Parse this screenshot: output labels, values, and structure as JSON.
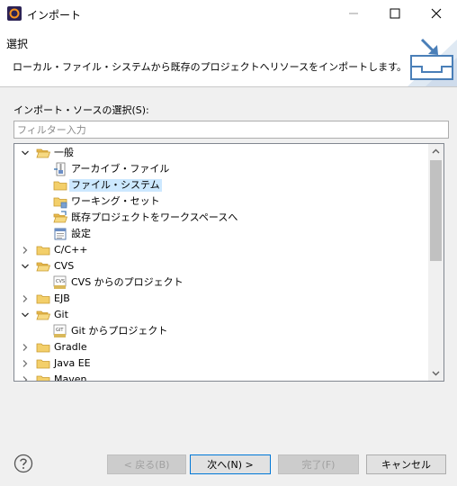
{
  "window": {
    "title": "インポート"
  },
  "banner": {
    "title": "選択",
    "description": "ローカル・ファイル・システムから既存のプロジェクトへリソースをインポートします。"
  },
  "source": {
    "label": "インポート・ソースの選択(S):",
    "filter_placeholder": "フィルター入力"
  },
  "tree": {
    "items": [
      {
        "label": "一般",
        "expanded": true,
        "icon": "folder-open-icon"
      },
      {
        "label": "アーカイブ・ファイル",
        "icon": "archive-file-icon"
      },
      {
        "label": "ファイル・システム",
        "icon": "folder-icon",
        "selected": true
      },
      {
        "label": "ワーキング・セット",
        "icon": "working-set-icon"
      },
      {
        "label": "既存プロジェクトをワークスペースへ",
        "icon": "project-folder-icon"
      },
      {
        "label": "設定",
        "icon": "settings-icon"
      },
      {
        "label": "C/C++",
        "expanded": false,
        "icon": "folder-icon"
      },
      {
        "label": "CVS",
        "expanded": true,
        "icon": "folder-open-icon"
      },
      {
        "label": "CVS からのプロジェクト",
        "icon": "cvs-icon"
      },
      {
        "label": "EJB",
        "expanded": false,
        "icon": "folder-icon"
      },
      {
        "label": "Git",
        "expanded": true,
        "icon": "folder-open-icon"
      },
      {
        "label": "Git からプロジェクト",
        "icon": "git-icon"
      },
      {
        "label": "Gradle",
        "expanded": false,
        "icon": "folder-icon"
      },
      {
        "label": "Java EE",
        "expanded": false,
        "icon": "folder-icon"
      },
      {
        "label": "Maven",
        "expanded": false,
        "icon": "folder-icon"
      }
    ]
  },
  "buttons": {
    "back": "< 戻る(B)",
    "next": "次へ(N) >",
    "finish": "完了(F)",
    "cancel": "キャンセル"
  },
  "colors": {
    "selection": "#cce8ff",
    "primary_border": "#0078d7"
  }
}
